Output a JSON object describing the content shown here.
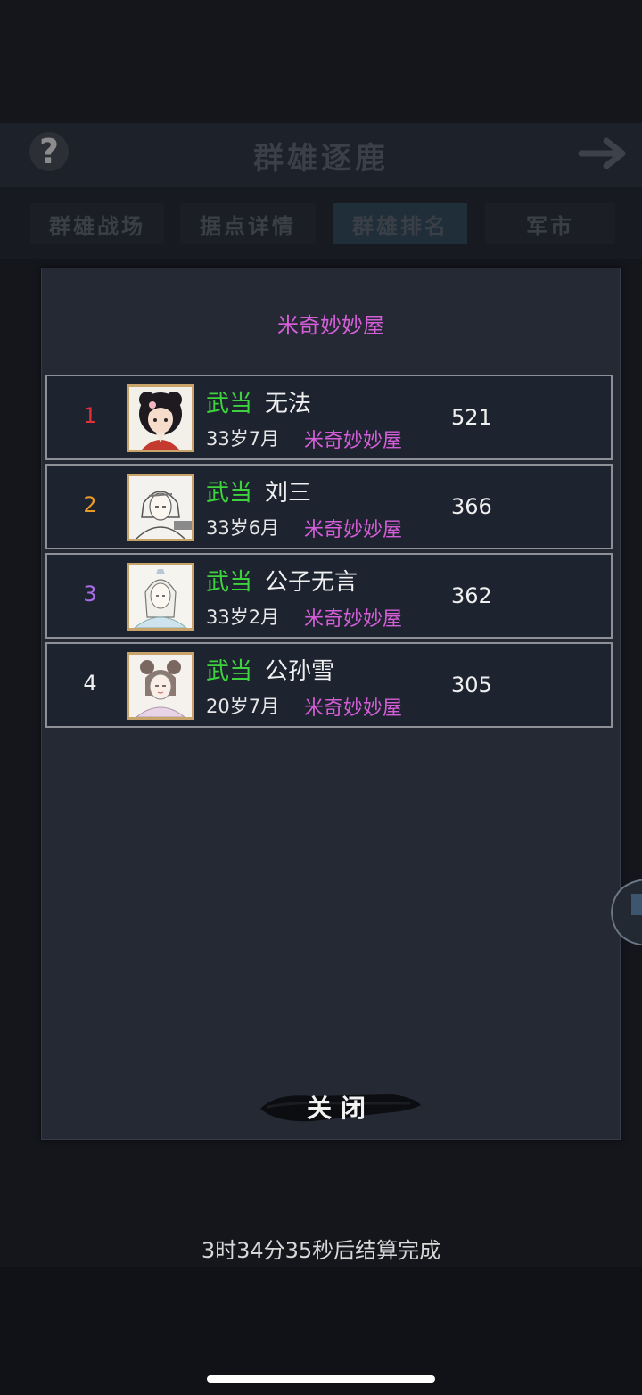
{
  "header": {
    "title": "群雄逐鹿",
    "help_label": "?"
  },
  "tabs": [
    {
      "label": "群雄战场",
      "active": false
    },
    {
      "label": "据点详情",
      "active": false
    },
    {
      "label": "群雄排名",
      "active": true
    },
    {
      "label": "军市",
      "active": false
    }
  ],
  "modal": {
    "title": "米奇妙妙屋",
    "close_label": "关闭",
    "ranking": [
      {
        "rank": "1",
        "rank_color": "#e0303a",
        "sect": "武当",
        "name": "无法",
        "age": "33岁7月",
        "guild": "米奇妙妙屋",
        "score": "521",
        "avatar_icon": "avatar-female-dark-hair"
      },
      {
        "rank": "2",
        "rank_color": "#e89a2a",
        "sect": "武当",
        "name": "刘三",
        "age": "33岁6月",
        "guild": "米奇妙妙屋",
        "score": "366",
        "avatar_icon": "avatar-male-sketch"
      },
      {
        "rank": "3",
        "rank_color": "#a86de8",
        "sect": "武当",
        "name": "公子无言",
        "age": "33岁2月",
        "guild": "米奇妙妙屋",
        "score": "362",
        "avatar_icon": "avatar-male-scholar"
      },
      {
        "rank": "4",
        "rank_color": "#f0f0f0",
        "sect": "武当",
        "name": "公孙雪",
        "age": "20岁7月",
        "guild": "米奇妙妙屋",
        "score": "305",
        "avatar_icon": "avatar-female-sketch"
      }
    ]
  },
  "status": {
    "countdown_text": "3时34分35秒后结算完成"
  },
  "colors": {
    "sect": "#3ed23e",
    "guild": "#d45ed8",
    "row_border": "#8e9097",
    "avatar_frame": "#c8a46a"
  }
}
